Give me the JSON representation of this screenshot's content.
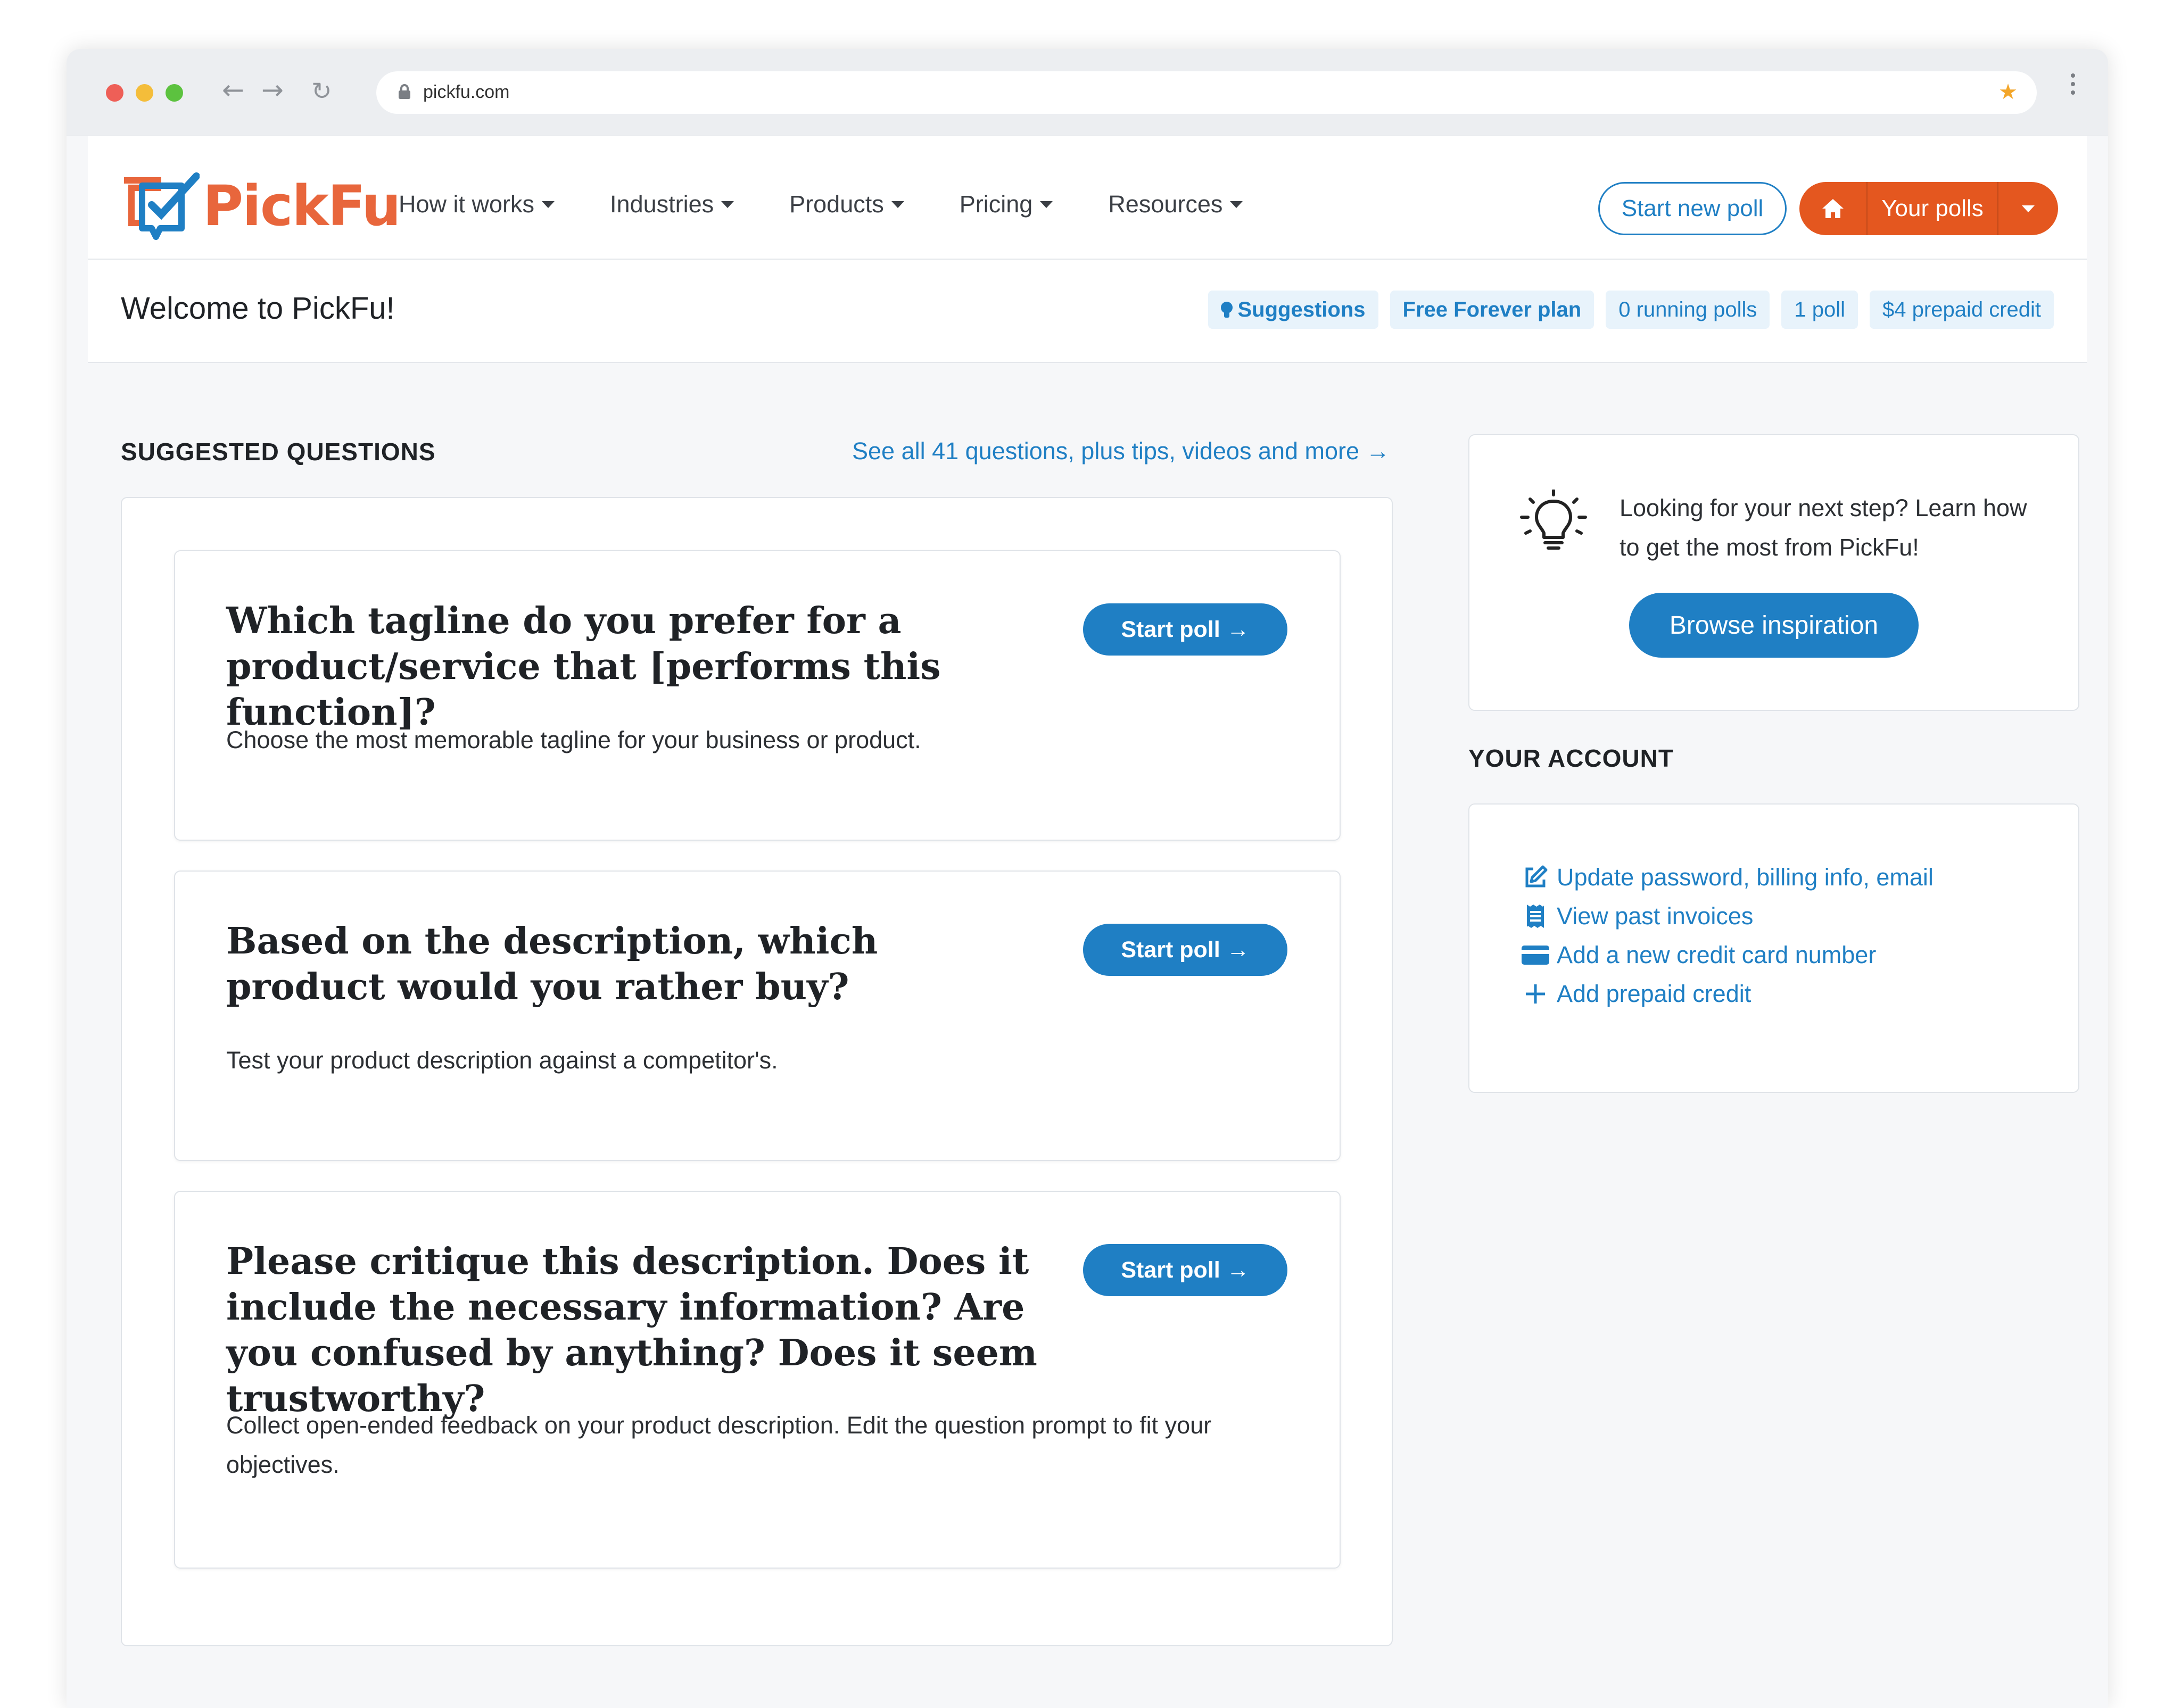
{
  "browser": {
    "url": "pickfu.com"
  },
  "brand": {
    "name": "PickFu",
    "accent_blue": "#1f7fc4",
    "accent_orange": "#e4571f"
  },
  "nav": {
    "items": [
      "How it works",
      "Industries",
      "Products",
      "Pricing",
      "Resources"
    ],
    "start_new_poll": "Start new poll",
    "your_polls": "Your polls"
  },
  "subheader": {
    "welcome": "Welcome to PickFu!",
    "badges": {
      "suggestions": "Suggestions",
      "plan": "Free Forever plan",
      "running": "0 running polls",
      "polls": "1 poll",
      "credit": "$4 prepaid credit"
    }
  },
  "suggested": {
    "heading": "SUGGESTED QUESTIONS",
    "see_all": "See all 41 questions, plus tips, videos and more →",
    "start_label": "Start poll →",
    "questions": [
      {
        "title": "Which tagline do you prefer for a product/service that [performs this function]?",
        "description": "Choose the most memorable tagline for your business or product."
      },
      {
        "title": "Based on the description, which product would you rather buy?",
        "description": "Test your product description against a competitor's."
      },
      {
        "title": "Please critique this description. Does it include the necessary information? Are you confused by anything? Does it seem trustworthy?",
        "description": "Collect open-ended feedback on your product description. Edit the question prompt to fit your objectives."
      }
    ]
  },
  "inspiration": {
    "text": "Looking for your next step? Learn how to get the most from PickFu!",
    "button": "Browse inspiration",
    "icon": "lightbulb-icon"
  },
  "account": {
    "heading": "YOUR ACCOUNT",
    "links": [
      {
        "label": "Update password, billing info, email",
        "icon": "edit-icon"
      },
      {
        "label": "View past invoices",
        "icon": "receipt-icon"
      },
      {
        "label": "Add a new credit card number",
        "icon": "credit-card-icon"
      },
      {
        "label": "Add prepaid credit",
        "icon": "plus-icon"
      }
    ]
  }
}
